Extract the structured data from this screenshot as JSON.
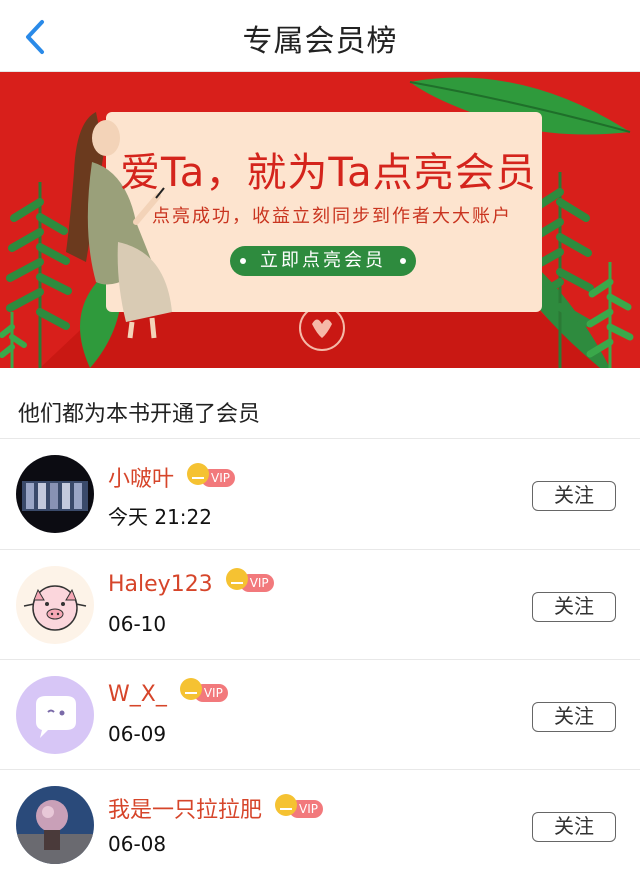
{
  "header": {
    "title": "专属会员榜",
    "back_icon": "chevron-left-icon"
  },
  "banner": {
    "headline": "爱Ta，就为Ta点亮会员",
    "subtitle": "点亮成功，收益立刻同步到作者大大账户",
    "button_label": "立即点亮会员",
    "colors": {
      "background": "#d81f1b",
      "card": "#fde4cf",
      "button": "#2e8b3e"
    }
  },
  "section": {
    "title": "他们都为本书开通了会员"
  },
  "members": [
    {
      "name": "小啵叶",
      "vip_label": "VIP",
      "date": "今天 21:22",
      "follow_label": "关注",
      "avatar": "concert-photo-avatar"
    },
    {
      "name": "Haley123",
      "vip_label": "VIP",
      "date": "06-10",
      "follow_label": "关注",
      "avatar": "pig-cartoon-avatar"
    },
    {
      "name": "W_X_",
      "vip_label": "VIP",
      "date": "06-09",
      "follow_label": "关注",
      "avatar": "chat-bubble-avatar"
    },
    {
      "name": "我是一只拉拉肥",
      "vip_label": "VIP",
      "date": "06-08",
      "follow_label": "关注",
      "avatar": "balloon-photo-avatar"
    }
  ],
  "colors": {
    "username": "#d6452a",
    "vip_badge": "#f2797c",
    "crown": "#f5c232",
    "back": "#2a8ae8"
  }
}
